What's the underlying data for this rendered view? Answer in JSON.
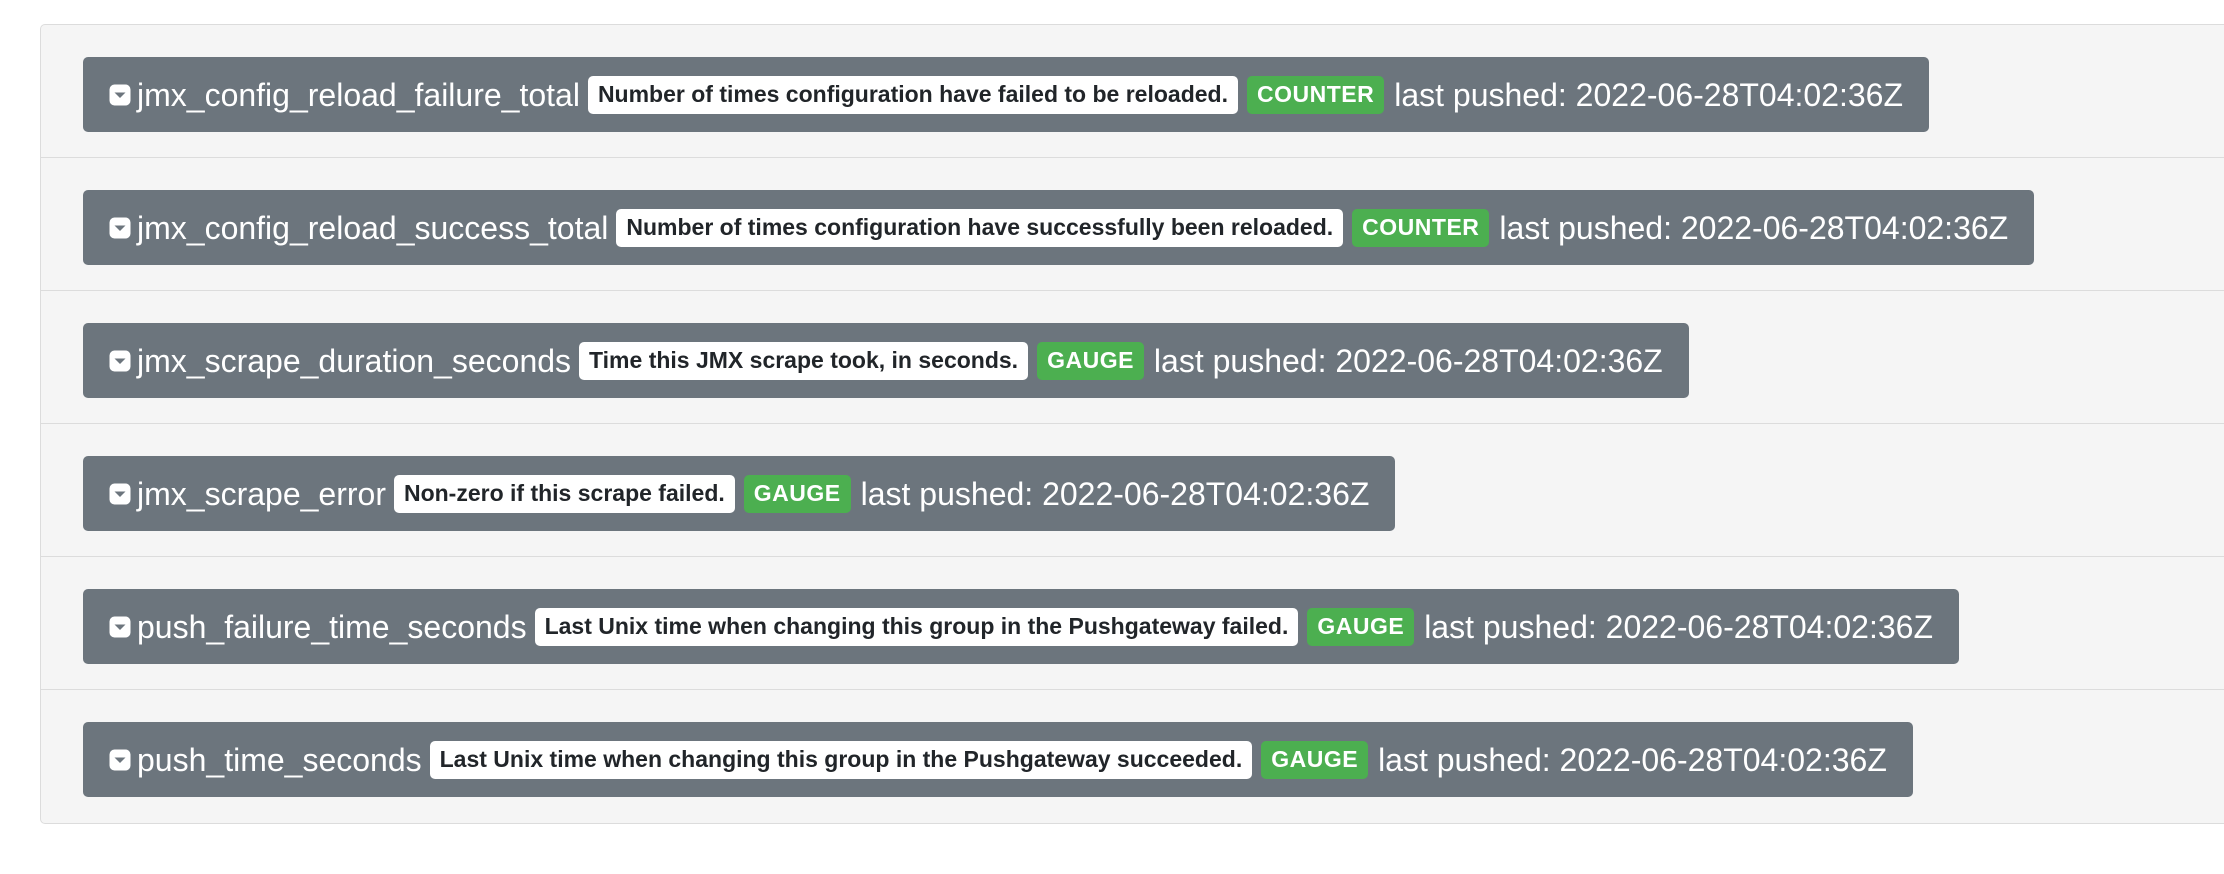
{
  "metrics": [
    {
      "name": "jmx_config_reload_failure_total",
      "help": "Number of times configuration have failed to be reloaded.",
      "type": "COUNTER",
      "last_pushed": "last pushed: 2022-06-28T04:02:36Z"
    },
    {
      "name": "jmx_config_reload_success_total",
      "help": "Number of times configuration have successfully been reloaded.",
      "type": "COUNTER",
      "last_pushed": "last pushed: 2022-06-28T04:02:36Z"
    },
    {
      "name": "jmx_scrape_duration_seconds",
      "help": "Time this JMX scrape took, in seconds.",
      "type": "GAUGE",
      "last_pushed": "last pushed: 2022-06-28T04:02:36Z"
    },
    {
      "name": "jmx_scrape_error",
      "help": "Non-zero if this scrape failed.",
      "type": "GAUGE",
      "last_pushed": "last pushed: 2022-06-28T04:02:36Z"
    },
    {
      "name": "push_failure_time_seconds",
      "help": "Last Unix time when changing this group in the Pushgateway failed.",
      "type": "GAUGE",
      "last_pushed": "last pushed: 2022-06-28T04:02:36Z"
    },
    {
      "name": "push_time_seconds",
      "help": "Last Unix time when changing this group in the Pushgateway succeeded.",
      "type": "GAUGE",
      "last_pushed": "last pushed: 2022-06-28T04:02:36Z"
    }
  ],
  "colors": {
    "metric_bg": "#6c757d",
    "type_badge": "#4caf50",
    "panel_bg": "#f5f5f5"
  },
  "icons": {
    "toggle": "caret-square-down-icon"
  }
}
